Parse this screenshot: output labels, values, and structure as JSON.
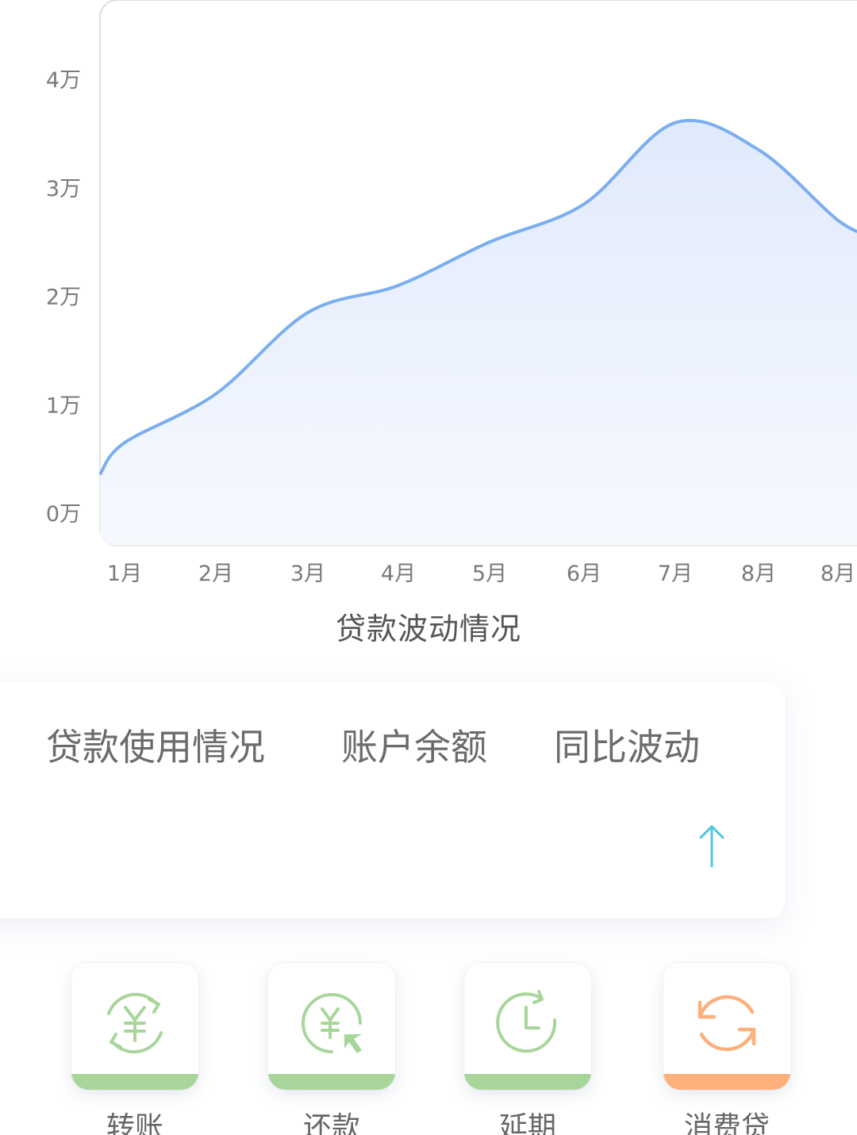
{
  "chart_data": {
    "type": "area",
    "title": "贷款波动情况",
    "categories": [
      "1月",
      "2月",
      "3月",
      "4月",
      "5月",
      "6月",
      "7月",
      "8月",
      "8月"
    ],
    "y_tick_labels": [
      "0万",
      "1万",
      "2万",
      "3万",
      "4万"
    ],
    "ylim": [
      0,
      40000
    ],
    "grid": false,
    "series": [
      {
        "values": [
          6500,
          11000,
          18500,
          21000,
          25000,
          28500,
          36000,
          33500,
          27000
        ],
        "color": "#7aaef0"
      }
    ]
  },
  "stats": {
    "labels": [
      "贷款使用情况",
      "账户余额",
      "同比波动"
    ],
    "arrow_icon": "arrow-up-icon",
    "arrow_color": "#4cc9de"
  },
  "actions": [
    {
      "label": "转账",
      "icon": "yuan-exchange-icon",
      "color": "#a8d69a"
    },
    {
      "label": "还款",
      "icon": "yuan-return-icon",
      "color": "#a8d69a"
    },
    {
      "label": "延期",
      "icon": "clock-refresh-icon",
      "color": "#a8d69a"
    },
    {
      "label": "消费贷",
      "icon": "refresh-icon",
      "color": "#fdb07a"
    }
  ]
}
